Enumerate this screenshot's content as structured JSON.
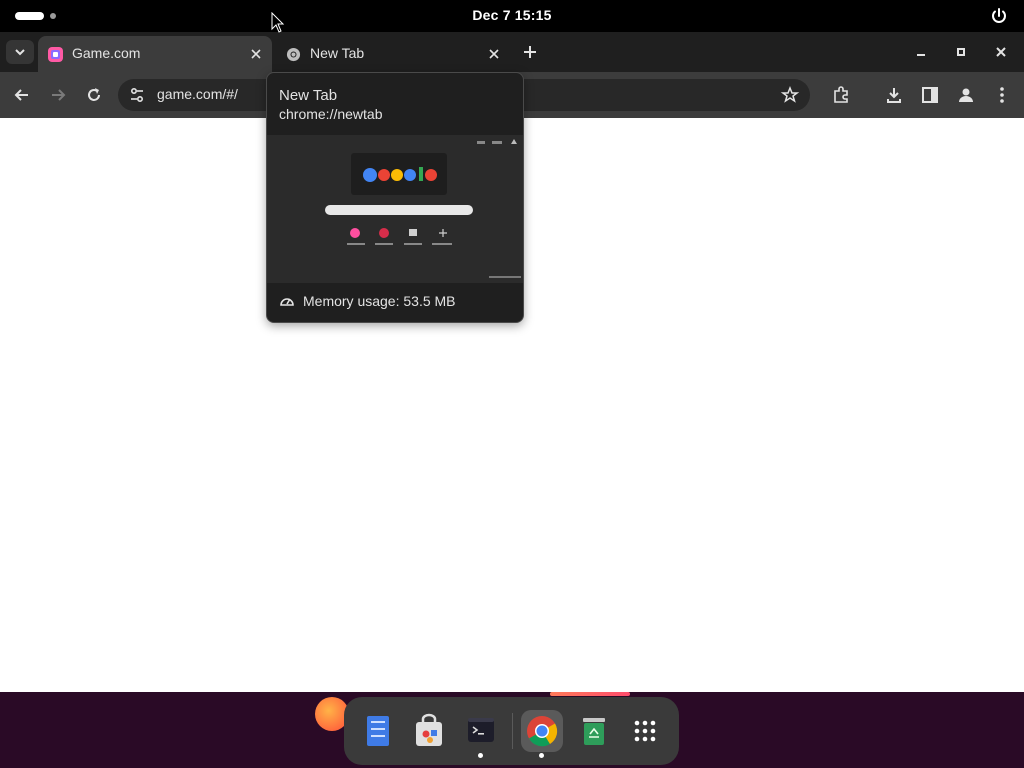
{
  "topbar": {
    "clock": "Dec 7  15:15"
  },
  "browser": {
    "tabs": [
      {
        "title": "Game.com",
        "favicon": "game-favicon-icon",
        "active": true
      },
      {
        "title": "New Tab",
        "favicon": "chrome-icon",
        "active": false
      }
    ],
    "omnibox": {
      "url": "game.com/#/"
    }
  },
  "hovercard": {
    "title": "New Tab",
    "url": "chrome://newtab",
    "memory": "Memory usage: 53.5 MB"
  },
  "dock": {
    "items": [
      {
        "name": "files-icon",
        "running": false
      },
      {
        "name": "software-store-icon",
        "running": false
      },
      {
        "name": "terminal-icon",
        "running": true
      },
      {
        "name": "chrome-icon",
        "running": true
      },
      {
        "name": "trash-icon",
        "running": false
      },
      {
        "name": "app-grid-icon",
        "running": false
      }
    ]
  },
  "colors": {
    "topbar": "#000000",
    "tabstrip": "#1f1f1f",
    "toolbar": "#3c3c3c",
    "desktop": "#2a0a26"
  }
}
